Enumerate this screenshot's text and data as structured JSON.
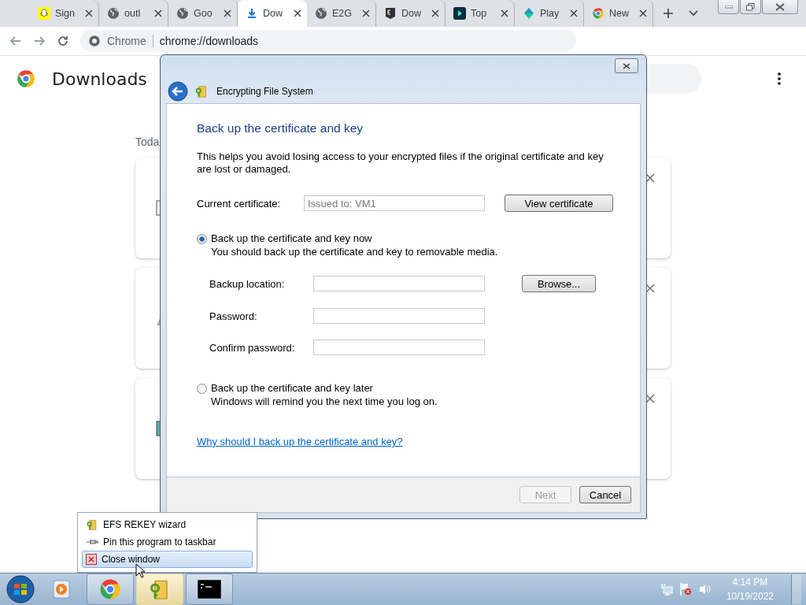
{
  "browser": {
    "tabs": [
      {
        "label": "Sign",
        "kind": "ghost",
        "selected": false
      },
      {
        "label": "outl",
        "kind": "globe",
        "selected": false
      },
      {
        "label": "Goo",
        "kind": "globe",
        "selected": false
      },
      {
        "label": "Dow",
        "kind": "download",
        "selected": true
      },
      {
        "label": "E2G",
        "kind": "globe",
        "selected": false
      },
      {
        "label": "Dow",
        "kind": "game",
        "selected": false
      },
      {
        "label": "Top",
        "kind": "play",
        "selected": false
      },
      {
        "label": "Play",
        "kind": "diamond",
        "selected": false
      },
      {
        "label": "New",
        "kind": "chrome",
        "selected": false
      }
    ],
    "address": {
      "site": "Chrome",
      "url": "chrome://downloads"
    }
  },
  "page": {
    "title": "Downloads",
    "section": "Toda",
    "cards": [
      {
        "kind": "document"
      },
      {
        "kind": "triangle"
      },
      {
        "kind": "image"
      }
    ]
  },
  "dialog": {
    "title": "Encrypting File System",
    "heading": "Back up the certificate and key",
    "intro": "This helps you avoid losing access to your encrypted files if the original certificate and key are lost or damaged.",
    "certificate": {
      "label": "Current certificate:",
      "value": "Issued to: VM1",
      "button": "View certificate"
    },
    "options": [
      {
        "label": "Back up the certificate and key now",
        "description": "You should back up the certificate and key to removable media.",
        "selected": true,
        "fields": [
          {
            "label": "Backup location:",
            "button": "Browse..."
          },
          {
            "label": "Password:"
          },
          {
            "label": "Confirm password:"
          }
        ]
      },
      {
        "label": "Back up the certificate and key later",
        "description": "Windows will remind you the next time you log on.",
        "selected": false
      }
    ],
    "link": "Why should I back up the certificate and key?",
    "buttons": [
      {
        "label": "Next",
        "disabled": true
      },
      {
        "label": "Cancel",
        "disabled": false
      }
    ]
  },
  "context_menu": {
    "items": [
      {
        "label": "EFS REKEY wizard",
        "kind": "app",
        "selected": false
      },
      {
        "label": "Pin this program to taskbar",
        "kind": "pin",
        "selected": false
      },
      {
        "label": "Close window",
        "kind": "close",
        "selected": true
      }
    ]
  },
  "taskbar": {
    "pinned": [
      {
        "kind": "media"
      }
    ],
    "apps": [
      {
        "kind": "chrome",
        "selected": false
      },
      {
        "kind": "keys",
        "selected": true
      },
      {
        "kind": "terminal",
        "selected": false
      }
    ],
    "clock": {
      "time": "4:14 PM",
      "date": "10/19/2022"
    }
  }
}
